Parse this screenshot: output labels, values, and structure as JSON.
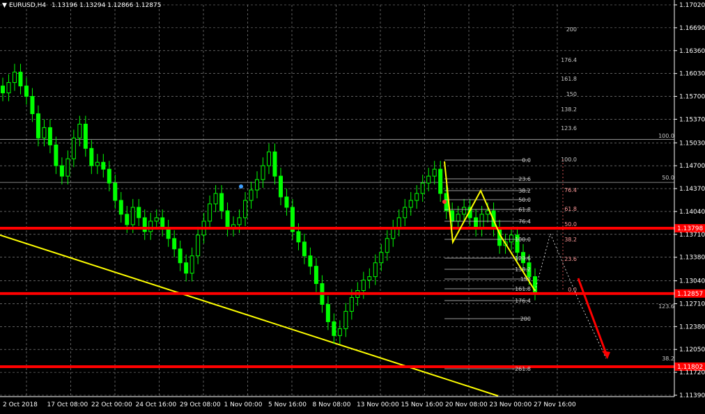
{
  "header": {
    "symbol": "EURUSD,H4",
    "ohlc": "1.13196 1.13294 1.12866 1.12875"
  },
  "colors": {
    "background": "#000000",
    "grid": "#9a9a9a",
    "candle": "#00ff00",
    "support_line": "#ff0000",
    "trend_line": "#ffff00",
    "fib_line": "#ffffff",
    "wave": "#ffff00",
    "projection": "#ff0000"
  },
  "chart_data": {
    "type": "candlestick",
    "y_ticks": [
      "1.17020",
      "1.16690",
      "1.16360",
      "1.16030",
      "1.15700",
      "1.15370",
      "1.15030",
      "1.14700",
      "1.14370",
      "1.14040",
      "1.13710",
      "1.13380",
      "1.13040",
      "1.12710",
      "1.12380",
      "1.12050",
      "1.11720",
      "1.11390"
    ],
    "ylim": [
      1.1139,
      1.1702
    ],
    "x_labels": [
      "2 Oct 2018",
      "17 Oct 08:00",
      "22 Oct 00:00",
      "24 Oct 16:00",
      "29 Oct 08:00",
      "1 Nov 00:00",
      "5 Nov 16:00",
      "8 Nov 08:00",
      "13 Nov 00:00",
      "15 Nov 16:00",
      "20 Nov 08:00",
      "23 Nov 00:00",
      "27 Nov 16:00"
    ],
    "close_series": [
      1.1575,
      1.159,
      1.1605,
      1.1585,
      1.157,
      1.1545,
      1.151,
      1.1525,
      1.15,
      1.147,
      1.1455,
      1.148,
      1.151,
      1.153,
      1.1495,
      1.147,
      1.1475,
      1.1465,
      1.1445,
      1.142,
      1.14,
      1.1385,
      1.141,
      1.1395,
      1.1375,
      1.139,
      1.1395,
      1.138,
      1.1365,
      1.135,
      1.133,
      1.1315,
      1.134,
      1.137,
      1.139,
      1.1415,
      1.143,
      1.1405,
      1.138,
      1.1385,
      1.1395,
      1.142,
      1.1435,
      1.145,
      1.147,
      1.149,
      1.1455,
      1.1425,
      1.141,
      1.1375,
      1.136,
      1.134,
      1.1325,
      1.13,
      1.127,
      1.1245,
      1.1225,
      1.1235,
      1.126,
      1.128,
      1.129,
      1.1305,
      1.131,
      1.133,
      1.1345,
      1.1365,
      1.138,
      1.1395,
      1.141,
      1.142,
      1.143,
      1.1445,
      1.1455,
      1.1465,
      1.143,
      1.1405,
      1.139,
      1.14,
      1.141,
      1.1395,
      1.138,
      1.14,
      1.1405,
      1.138,
      1.1355,
      1.136,
      1.137,
      1.1345,
      1.133,
      1.131,
      1.1288
    ],
    "horizontal_levels": [
      {
        "price": 1.13798,
        "label": "1.13798"
      },
      {
        "price": 1.12857,
        "label": "1.12857"
      },
      {
        "price": 1.11802,
        "label": "1.11802"
      }
    ],
    "fib_left": [
      "0.0",
      "23.6",
      "38.2",
      "50.0",
      "61.8",
      "76.4",
      "100.0",
      "123.6",
      "138.2",
      "150",
      "161.8",
      "176.4",
      "200",
      "261.8"
    ],
    "fib_right": [
      "200",
      "176.4",
      "161.8",
      "150",
      "138.2",
      "123.6",
      "100.0",
      "76.4",
      "61.8",
      "50.0",
      "38.2",
      "23.6",
      "0.0"
    ],
    "fib_far": [
      "100.0",
      "50.0",
      "123.6",
      "38.2"
    ]
  }
}
